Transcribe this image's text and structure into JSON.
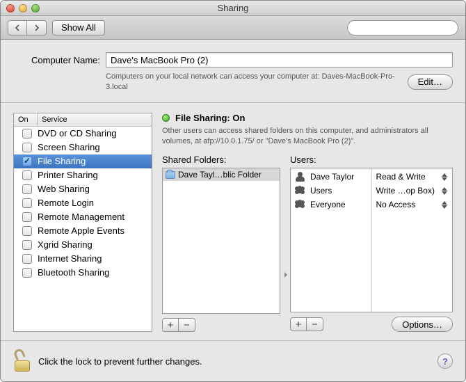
{
  "window": {
    "title": "Sharing"
  },
  "toolbar": {
    "show_all_label": "Show All",
    "search_placeholder": ""
  },
  "computer_name": {
    "label": "Computer Name:",
    "value": "Dave's MacBook Pro (2)",
    "help": "Computers on your local network can access your computer at: Daves-MacBook-Pro-3.local",
    "edit_label": "Edit…"
  },
  "services": {
    "head_on": "On",
    "head_service": "Service",
    "items": [
      {
        "label": "DVD or CD Sharing",
        "on": false,
        "selected": false
      },
      {
        "label": "Screen Sharing",
        "on": false,
        "selected": false
      },
      {
        "label": "File Sharing",
        "on": true,
        "selected": true
      },
      {
        "label": "Printer Sharing",
        "on": false,
        "selected": false
      },
      {
        "label": "Web Sharing",
        "on": false,
        "selected": false
      },
      {
        "label": "Remote Login",
        "on": false,
        "selected": false
      },
      {
        "label": "Remote Management",
        "on": false,
        "selected": false
      },
      {
        "label": "Remote Apple Events",
        "on": false,
        "selected": false
      },
      {
        "label": "Xgrid Sharing",
        "on": false,
        "selected": false
      },
      {
        "label": "Internet Sharing",
        "on": false,
        "selected": false
      },
      {
        "label": "Bluetooth Sharing",
        "on": false,
        "selected": false
      }
    ]
  },
  "detail": {
    "status_title": "File Sharing: On",
    "status_desc": "Other users can access shared folders on this computer, and administrators all volumes, at afp://10.0.1.75/ or \"Dave's MacBook Pro (2)\".",
    "shared_folders_label": "Shared Folders:",
    "users_label": "Users:",
    "shared_folders": [
      {
        "label": "Dave Tayl…blic Folder"
      }
    ],
    "users": [
      {
        "name": "Dave Taylor",
        "icon": "single",
        "perm": "Read & Write"
      },
      {
        "name": "Users",
        "icon": "group",
        "perm": "Write …op Box)"
      },
      {
        "name": "Everyone",
        "icon": "group",
        "perm": "No Access"
      }
    ],
    "options_label": "Options…"
  },
  "footer": {
    "lock_text": "Click the lock to prevent further changes."
  }
}
